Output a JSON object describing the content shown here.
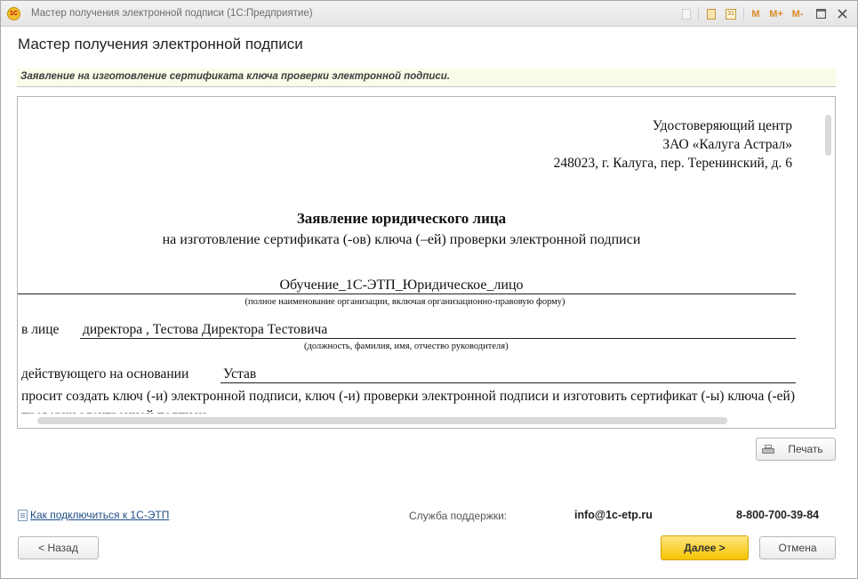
{
  "window": {
    "title": "Мастер получения электронной подписи  (1С:Предприятие)",
    "app_icon_text": "1С",
    "toolbar": {
      "m_label": "M",
      "m_plus_label": "M+",
      "m_minus_label": "M-",
      "calendar_label": "31"
    }
  },
  "page": {
    "title": "Мастер получения электронной подписи",
    "info_text": "Заявление на изготовление сертификата ключа проверки электронной подписи."
  },
  "document": {
    "address": [
      "Удостоверяющий центр",
      "ЗАО «Калуга Астрал»",
      "248023, г. Калуга, пер. Теренинский, д. 6"
    ],
    "title": "Заявление юридического лица",
    "subtitle": "на изготовление сертификата (-ов) ключа (–ей) проверки электронной подписи",
    "org_name": "Обучение_1С-ЭТП_Юридическое_лицо",
    "org_note": "(полное наименование организации, включая организационно-правовую форму)",
    "person_prefix": "в лице",
    "person_value": "директора , Тестова Директора Тестовича",
    "person_note": "(должность, фамилия, имя, отчество руководителя)",
    "basis_prefix": "действующего на основании",
    "basis_value": "Устав",
    "request_text": "просит создать ключ (-и) электронной подписи, ключ (-и) проверки электронной подписи и изготовить сертификат (-ы) ключа (-ей) проверки электронной подписи"
  },
  "buttons": {
    "print": "Печать",
    "back": "< Назад",
    "next": "Далее >",
    "cancel": "Отмена"
  },
  "footer": {
    "help_link": "Как подключиться к 1С-ЭТП",
    "support_label": "Служба поддержки:",
    "support_email": "info@1c-etp.ru",
    "support_phone": "8-800-700-39-84"
  },
  "colors": {
    "accent_button": "#f4c400",
    "link": "#1e4d87",
    "info_bar": "#fbfbe9"
  }
}
